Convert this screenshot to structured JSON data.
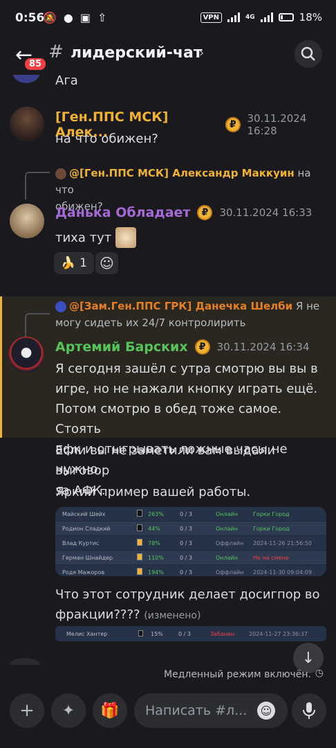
{
  "status_bar": {
    "time": "0:56",
    "vpn": "VPN",
    "network": "4G",
    "battery": "18%"
  },
  "header": {
    "unread_badge": "85",
    "channel_name": "лидерский-чат"
  },
  "messages": {
    "m0": {
      "text": "Ага"
    },
    "m1": {
      "author": "[Ген.ППС МСК] Алек...",
      "timestamp": "30.11.2024 16:28",
      "text": "на что обижен?"
    },
    "m2": {
      "reply_author": "@[Ген.ППС МСК] Александр Маккуин",
      "reply_text_a": "на что",
      "reply_text_b": "обижен?",
      "author": "Данька Обладает",
      "timestamp": "30.11.2024 16:33",
      "text": "тиха тут",
      "reaction_count": "1"
    },
    "m3": {
      "reply_author": "@[Зам.Ген.ППС ГРК] Данечка Шелби",
      "reply_text_a": "Я не",
      "reply_text_b": "могу сидеть их 24/7 контролирить",
      "author": "Артемий Барских",
      "timestamp": "30.11.2024 16:34",
      "lines": [
        "Я сегодня зашёл с утра смотрю вы вы в",
        "игре, но не нажали кнопку играть ещё.",
        "Потом смотрю в обед тоже самое. Стоять",
        "афк и отыгрывать ложные часы не нужно."
      ],
      "text2_a": "Если вы не заметили вам выдали выговор",
      "text2_b": "за АФК.",
      "text3": "Яркий пример вашей работы.",
      "text4_a": "Что этот сотрудник делает досигпор во",
      "text4_b": "фракции????",
      "edited": "(изменено)"
    }
  },
  "embed_table": {
    "rows": [
      {
        "name": "Майский Шейх",
        "pct": "263%",
        "ratio": "0 / 3",
        "status": "Онлайн",
        "place": "Горки Город"
      },
      {
        "name": "Родион Сладкий",
        "pct": "44%",
        "ratio": "0 / 3",
        "status": "Онлайн",
        "place": "Горки Город"
      },
      {
        "name": "Влад Куртис",
        "pct": "78%",
        "ratio": "0 / 3",
        "status": "Оффлайн",
        "place": "2024-11-26 21:56:50"
      },
      {
        "name": "Герман Шнайдер",
        "pct": "110%",
        "ratio": "0 / 3",
        "status": "Онлайн",
        "place": "Не на смене"
      },
      {
        "name": "Родя Мажоров",
        "pct": "194%",
        "ratio": "0 / 3",
        "status": "Оффлайн",
        "place": "2024-11-30 09:04:09"
      }
    ]
  },
  "embed2": {
    "name": "Мелис Хантер",
    "pct": "15%",
    "ratio": "0 / 3",
    "status": "Забанен",
    "place": "2024-11-27 23:36:37"
  },
  "bottom": {
    "slowmode": "Медленный режим включён.",
    "placeholder": "Написать #л..."
  },
  "colors": {
    "gen_msk": "#f0b232",
    "purple": "#a66ad6",
    "green": "#57c45a",
    "orange": "#e67e22",
    "highlight": "#2a2720"
  }
}
